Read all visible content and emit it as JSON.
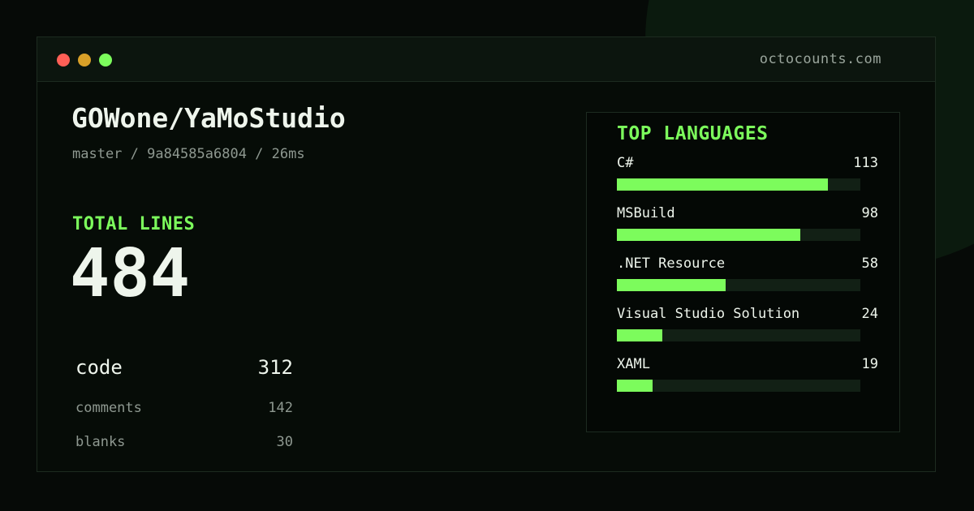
{
  "window": {
    "site": "octocounts.com"
  },
  "repo": {
    "name": "GOWone/YaMoStudio",
    "meta": "master / 9a84585a6804 / 26ms"
  },
  "totals": {
    "heading": "TOTAL LINES",
    "value": "484",
    "breakdown": [
      {
        "label": "code",
        "value": "312"
      },
      {
        "label": "comments",
        "value": "142"
      },
      {
        "label": "blanks",
        "value": "30"
      }
    ]
  },
  "languages": {
    "heading": "TOP LANGUAGES",
    "items": [
      {
        "name": "C#",
        "count": "113",
        "fraction": 0.867
      },
      {
        "name": "MSBuild",
        "count": "98",
        "fraction": 0.753
      },
      {
        "name": ".NET Resource",
        "count": "58",
        "fraction": 0.447
      },
      {
        "name": "Visual Studio Solution",
        "count": "24",
        "fraction": 0.187
      },
      {
        "name": "XAML",
        "count": "19",
        "fraction": 0.147
      }
    ]
  },
  "colors": {
    "accent": "#7cfc5c",
    "background": "#060a07",
    "text": "#eef5ec",
    "muted": "#8e9890",
    "bar_track": "#122015",
    "dot_red": "#ff5f56",
    "dot_yellow": "#d9a028",
    "dot_green": "#7cfc5c"
  }
}
